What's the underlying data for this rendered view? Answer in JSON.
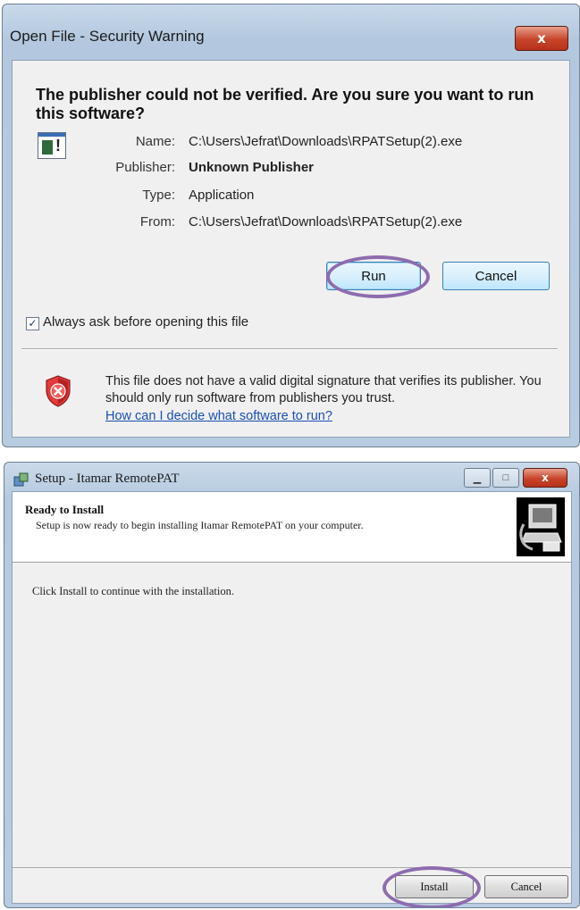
{
  "security_dialog": {
    "title": "Open File - Security Warning",
    "close_glyph": "x",
    "headline": "The publisher could not be verified.  Are you sure you want to run this software?",
    "fields": [
      {
        "label": "Name:",
        "value": "C:\\Users\\Jefrat\\Downloads\\RPATSetup(2).exe"
      },
      {
        "label": "Publisher:",
        "value": "Unknown Publisher"
      },
      {
        "label": "Type:",
        "value": "Application"
      },
      {
        "label": "From:",
        "value": "C:\\Users\\Jefrat\\Downloads\\RPATSetup(2).exe"
      }
    ],
    "run_label": "Run",
    "cancel_label": "Cancel",
    "checkbox_label": "Always ask before opening this file",
    "checkbox_checked": true,
    "warning_text": "This file does not have a valid digital signature that verifies its publisher.  You should only run software from publishers you trust.",
    "help_link": "How can I decide what software to run?",
    "icons": [
      "application-file-icon",
      "security-shield-icon"
    ]
  },
  "setup_dialog": {
    "title": "Setup - Itamar RemotePAT",
    "close_glyph": "x",
    "page_title": "Ready to Install",
    "page_subtitle": "Setup is now ready to begin installing Itamar RemotePAT on your computer.",
    "body_text": "Click Install to continue with the installation.",
    "install_label": "Install",
    "cancel_label": "Cancel",
    "icons": [
      "setup-icon",
      "computer-install-icon",
      "minimize-icon",
      "maximize-icon",
      "close-icon"
    ]
  },
  "colors": {
    "highlight_oval": "#8e6cb0",
    "link": "#1a4fb3",
    "close_button": "#c7442a"
  }
}
